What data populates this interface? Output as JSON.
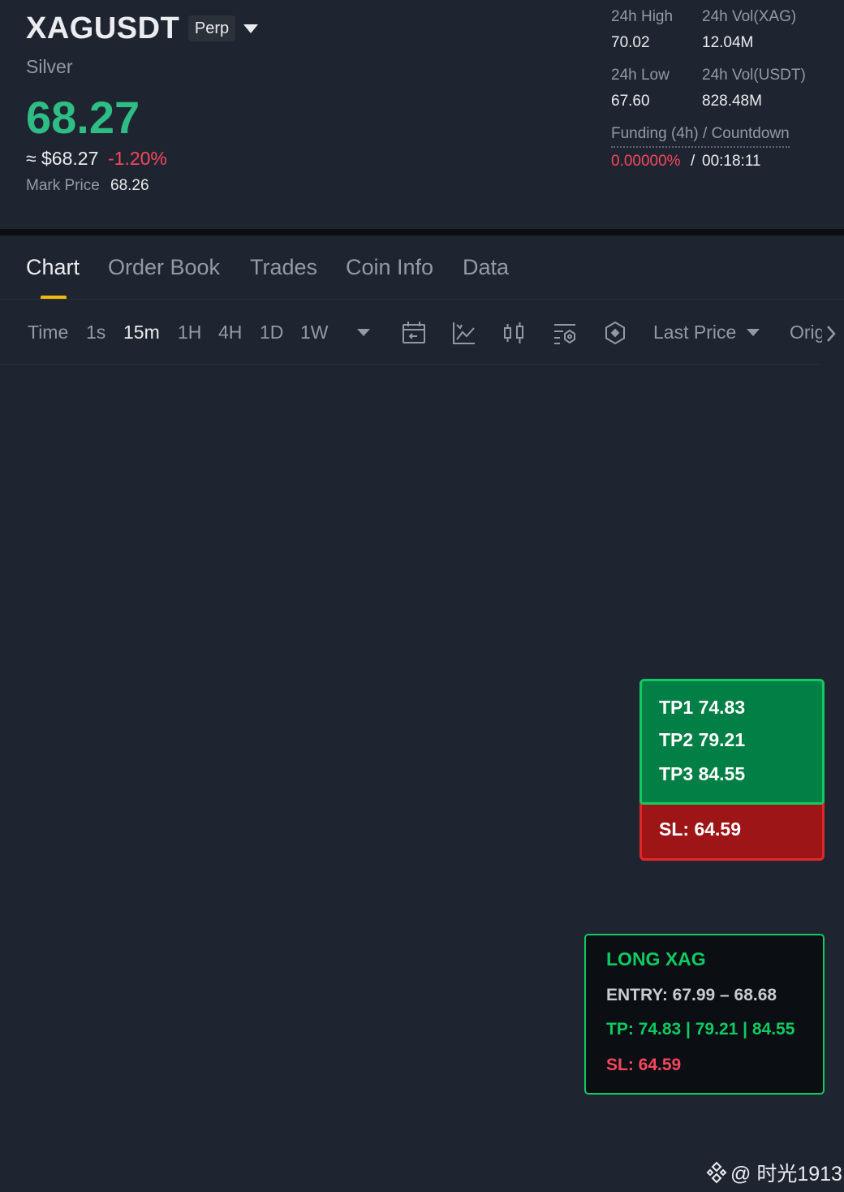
{
  "header": {
    "symbol": "XAGUSDT",
    "contract_type": "Perp",
    "name": "Silver",
    "last_price": "68.27",
    "approx_price": "≈ $68.27",
    "change_pct": "-1.20%",
    "mark_price_label": "Mark Price",
    "mark_price": "68.26"
  },
  "stats": {
    "high_label": "24h High",
    "high_value": "70.02",
    "vol_base_label": "24h Vol(XAG)",
    "vol_base_value": "12.04M",
    "low_label": "24h Low",
    "low_value": "67.60",
    "vol_quote_label": "24h Vol(USDT)",
    "vol_quote_value": "828.48M",
    "funding_label": "Funding (4h) / Countdown",
    "funding_rate": "0.00000%",
    "funding_sep": "/",
    "countdown": "00:18:11"
  },
  "tabs": [
    {
      "label": "Chart",
      "active": true
    },
    {
      "label": "Order Book"
    },
    {
      "label": "Trades"
    },
    {
      "label": "Coin Info"
    },
    {
      "label": "Data"
    }
  ],
  "toolbar": {
    "intervals": [
      "Time",
      "1s",
      "15m",
      "1H",
      "4H",
      "1D",
      "1W"
    ],
    "active_interval": "15m",
    "price_type": "Last Price",
    "view_mode": "Orig"
  },
  "targets": {
    "tp1": "TP1 74.83",
    "tp2": "TP2 79.21",
    "tp3": "TP3 84.55",
    "sl": "SL: 64.59"
  },
  "signal": {
    "title": "LONG XAG",
    "entry": "ENTRY: 67.99 – 68.68",
    "tp": "TP: 74.83 | 79.21 | 84.55",
    "sl": "SL: 64.59"
  },
  "watermark": "@ 时光1913",
  "colors": {
    "background": "#1f2530",
    "up": "#2ebd85",
    "down": "#f6465d",
    "accent": "#f0b90b",
    "tp_fill": "#027f45",
    "sl_fill": "#9e1518"
  }
}
